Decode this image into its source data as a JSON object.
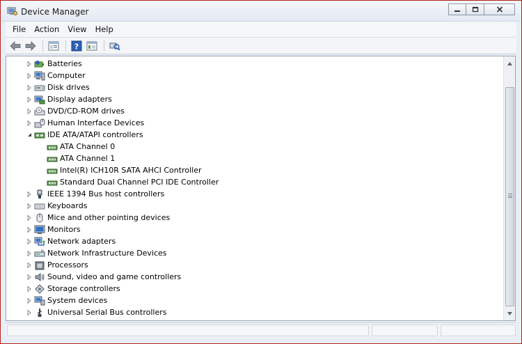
{
  "window": {
    "title": "Device Manager",
    "icon": "device-manager-icon",
    "buttons": [
      "minimize-icon",
      "maximize-icon",
      "close-icon"
    ]
  },
  "menu": {
    "items": [
      "File",
      "Action",
      "View",
      "Help"
    ]
  },
  "toolbar": {
    "buttons": [
      "back-arrow-icon",
      "forward-arrow-icon",
      "properties-icon",
      "help-icon",
      "update-driver-icon",
      "scan-hardware-icon"
    ]
  },
  "tree": {
    "categories": [
      {
        "label": "Batteries",
        "icon": "battery-icon"
      },
      {
        "label": "Computer",
        "icon": "computer-icon"
      },
      {
        "label": "Disk drives",
        "icon": "disk-drive-icon"
      },
      {
        "label": "Display adapters",
        "icon": "display-adapter-icon"
      },
      {
        "label": "DVD/CD-ROM drives",
        "icon": "dvd-drive-icon"
      },
      {
        "label": "Human Interface Devices",
        "icon": "hid-icon"
      },
      {
        "label": "IDE ATA/ATAPI controllers",
        "icon": "ide-controller-icon",
        "expanded": true,
        "children": [
          "ATA Channel 0",
          "ATA Channel 1",
          "Intel(R) ICH10R SATA AHCI Controller",
          "Standard Dual Channel PCI IDE Controller"
        ]
      },
      {
        "label": "IEEE 1394 Bus host controllers",
        "icon": "firewire-icon"
      },
      {
        "label": "Keyboards",
        "icon": "keyboard-icon"
      },
      {
        "label": "Mice and other pointing devices",
        "icon": "mouse-icon"
      },
      {
        "label": "Monitors",
        "icon": "monitor-icon"
      },
      {
        "label": "Network adapters",
        "icon": "network-adapter-icon"
      },
      {
        "label": "Network Infrastructure Devices",
        "icon": "network-infrastructure-icon"
      },
      {
        "label": "Processors",
        "icon": "processor-icon"
      },
      {
        "label": "Sound, video and game controllers",
        "icon": "sound-icon"
      },
      {
        "label": "Storage controllers",
        "icon": "storage-controller-icon"
      },
      {
        "label": "System devices",
        "icon": "system-devices-icon"
      },
      {
        "label": "Universal Serial Bus controllers",
        "icon": "usb-icon"
      }
    ]
  }
}
